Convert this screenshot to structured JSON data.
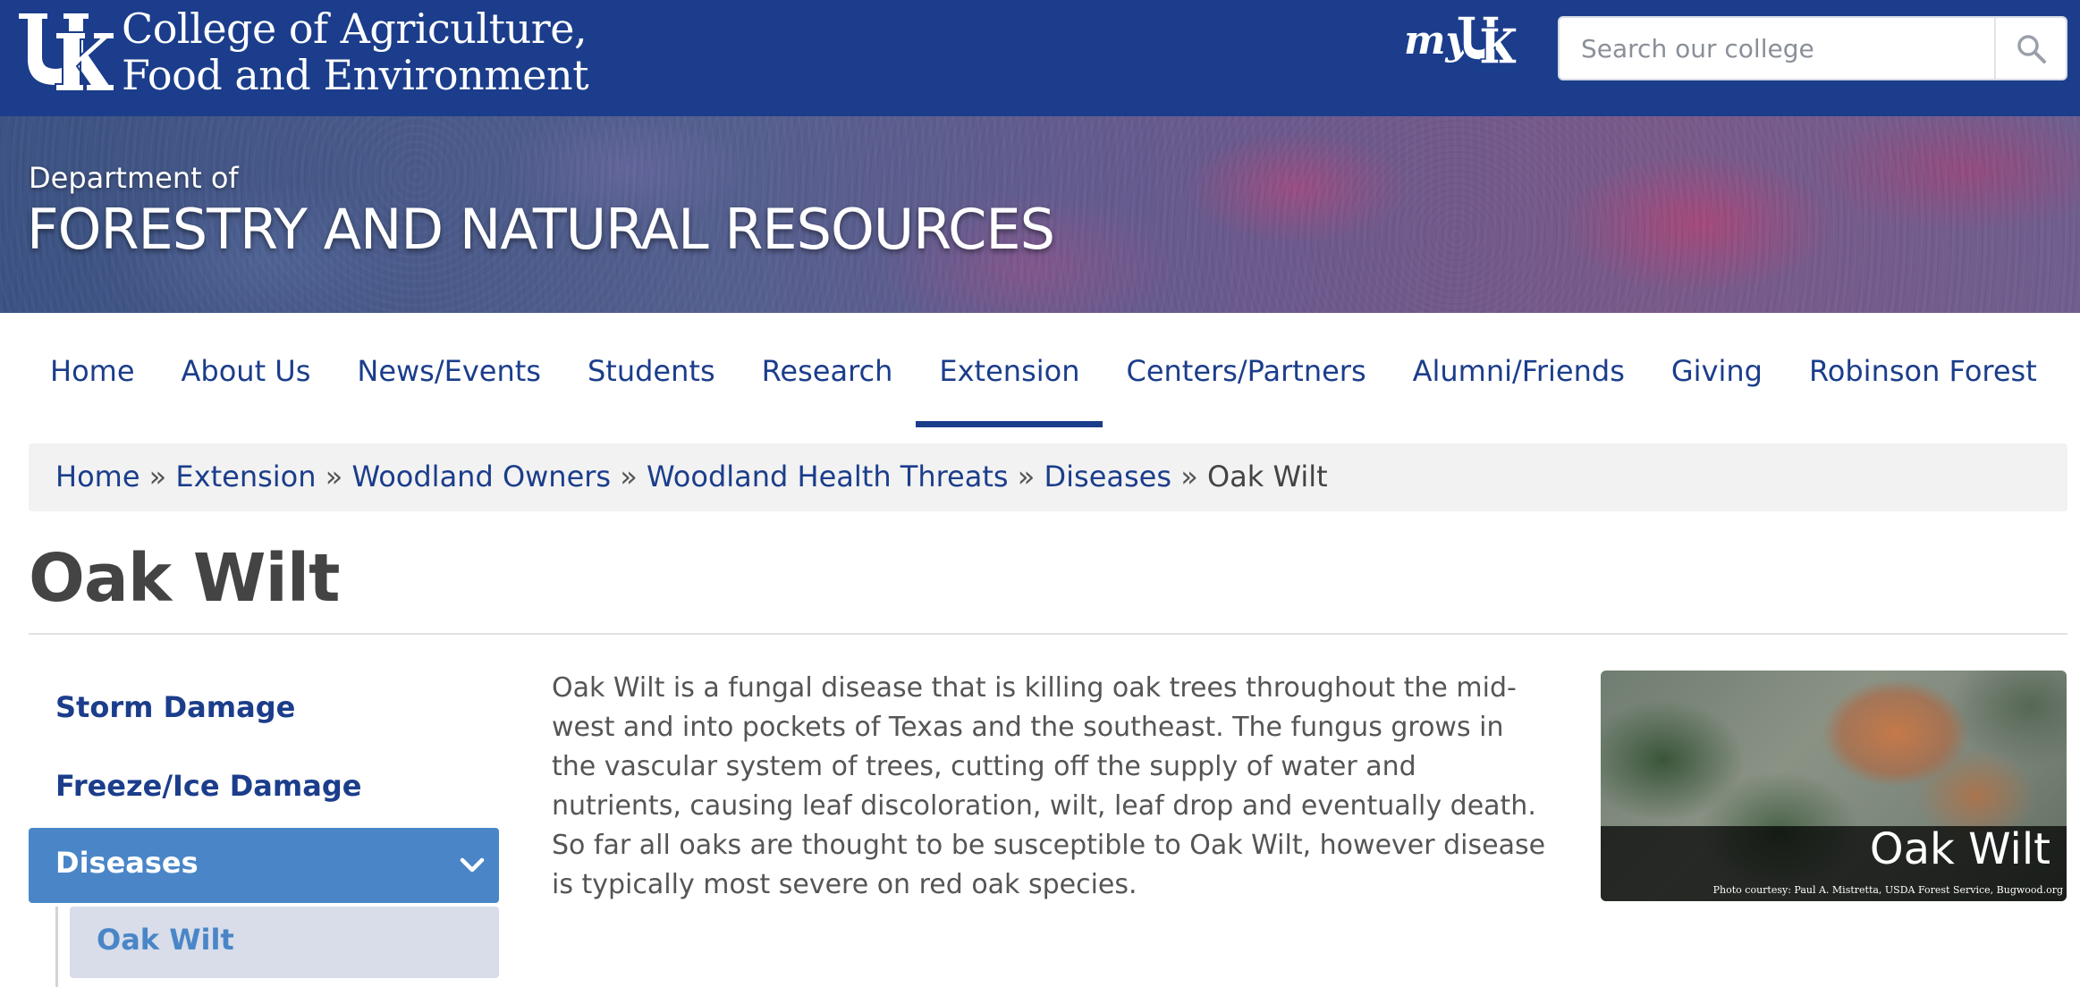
{
  "header": {
    "college_line1": "College of Agriculture,",
    "college_line2": "Food and Environment",
    "myuk_label": "my",
    "search": {
      "placeholder": "Search our college",
      "button_icon": "search-icon"
    },
    "colors": {
      "topbar": "#1b3d8b"
    }
  },
  "banner": {
    "dept_of": "Department of",
    "dept_name": "FORESTRY AND NATURAL RESOURCES"
  },
  "nav": {
    "items": [
      {
        "label": "Home"
      },
      {
        "label": "About Us"
      },
      {
        "label": "News/Events"
      },
      {
        "label": "Students"
      },
      {
        "label": "Research"
      },
      {
        "label": "Extension",
        "active": true
      },
      {
        "label": "Centers/Partners"
      },
      {
        "label": "Alumni/Friends"
      },
      {
        "label": "Giving"
      },
      {
        "label": "Robinson Forest"
      }
    ]
  },
  "breadcrumb": {
    "items": [
      "Home",
      "Extension",
      "Woodland Owners",
      "Woodland Health Threats",
      "Diseases"
    ],
    "separator": "»",
    "current": "Oak Wilt"
  },
  "page": {
    "title": "Oak Wilt"
  },
  "sidebar": {
    "items": [
      {
        "label": "Storm Damage"
      },
      {
        "label": "Freeze/Ice Damage"
      }
    ],
    "active": {
      "label": "Diseases",
      "icon": "chevron-down-icon"
    },
    "sub_active": {
      "label": "Oak Wilt"
    },
    "colors": {
      "active_bg": "#4a86c7",
      "sub_bg": "#d8dde9"
    }
  },
  "content": {
    "paragraph": "Oak Wilt is a fungal disease that is killing oak trees throughout the mid-west and into pockets of Texas and the southeast.  The fungus grows in the vascular system of trees, cutting off the supply of water and nutrients, causing leaf discoloration, wilt, leaf drop and eventually death.  So far all oaks are thought to be susceptible to Oak Wilt, however disease is typically most severe on red oak species."
  },
  "figure": {
    "caption": "Oak Wilt",
    "credit": "Photo courtesy: Paul A. Mistretta, USDA Forest Service, Bugwood.org"
  }
}
